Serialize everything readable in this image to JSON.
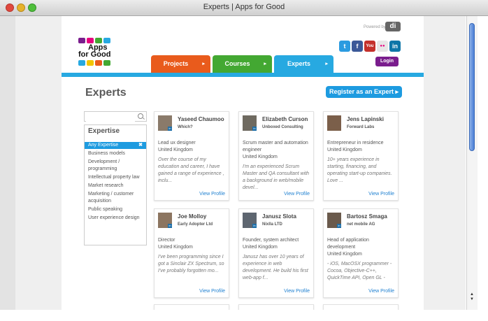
{
  "window": {
    "title": "Experts | Apps for Good"
  },
  "header": {
    "powered_by": "Powered by",
    "powered_logo": "di",
    "logo_line1": "Apps",
    "logo_line2": "for Good",
    "social": [
      {
        "icon": "twitter-icon",
        "glyph": "t",
        "color": "#2b9be0"
      },
      {
        "icon": "facebook-icon",
        "glyph": "f",
        "color": "#3b5998"
      },
      {
        "icon": "youtube-icon",
        "glyph": "You",
        "color": "#c4302b"
      },
      {
        "icon": "flickr-icon",
        "glyph": "●●",
        "color": "#e6e6e6"
      },
      {
        "icon": "linkedin-icon",
        "glyph": "in",
        "color": "#0e76a8"
      }
    ],
    "login": "Login"
  },
  "nav": {
    "tabs": [
      {
        "label": "Projects",
        "color": "#e95b1c"
      },
      {
        "label": "Courses",
        "color": "#43a832"
      },
      {
        "label": "Experts",
        "color": "#27a9e1"
      }
    ]
  },
  "main": {
    "title": "Experts",
    "register_label": "Register as an Expert ▸"
  },
  "sidebar": {
    "search_placeholder": "",
    "filter_title": "Expertise",
    "items": [
      {
        "label": "Any Expertise",
        "active": true
      },
      {
        "label": "Business models"
      },
      {
        "label": "Development /"
      },
      {
        "label": "programming"
      },
      {
        "label": "Intellectual property law"
      },
      {
        "label": "Market research"
      },
      {
        "label": "Marketing / customer"
      },
      {
        "label": "acquisition"
      },
      {
        "label": "Public speaking"
      },
      {
        "label": "User experience design"
      }
    ],
    "close_glyph": "✖"
  },
  "experts": [
    {
      "name": "Yaseed Chaumoo",
      "org": "Which?",
      "role": "Lead ux designer\nUnited Kingdom",
      "bio": "Over the course of my education and career, I have gained a range of experience , inclu...",
      "view": "View Profile"
    },
    {
      "name": "Elizabeth Curson",
      "org": "Unboxed Consulting",
      "role": "Scrum master and automation engineer\nUnited Kingdom",
      "bio": "I'm an experienced Scrum Master and QA consultant with a background in web/mobile devel...",
      "view": "View Profile"
    },
    {
      "name": "Jens Lapinski",
      "org": "Forward Labs",
      "role": "Entrepreneur in residence\nUnited Kingdom",
      "bio": "10+ years experience in starting, financing, and operating start-up companies. Love ...",
      "view": "View Profile"
    },
    {
      "name": "Joe Molloy",
      "org": "Early Adopter Ltd",
      "role": "Director\nUnited Kingdom",
      "bio": "I've been programming since I got a Sinclair ZX Spectrum, so I've probably forgotten mo...",
      "view": "View Profile"
    },
    {
      "name": "Janusz Slota",
      "org": "Nixlla LTD",
      "role": "Founder, system architect\nUnited Kingdom",
      "bio": "Janusz has over 10 years of experience in web development. He build his first web-app f...",
      "view": "View Profile"
    },
    {
      "name": "Bartosz Smaga",
      "org": "net mobile AG",
      "role": "Head of application development\nUnited Kingdom",
      "bio": "- iOS, MacOSX programmer - Cocoa, Objective-C++, QuickTime API, Open GL -",
      "view": "View Profile"
    }
  ],
  "scroll": {
    "arrows": "▲\n▼"
  }
}
